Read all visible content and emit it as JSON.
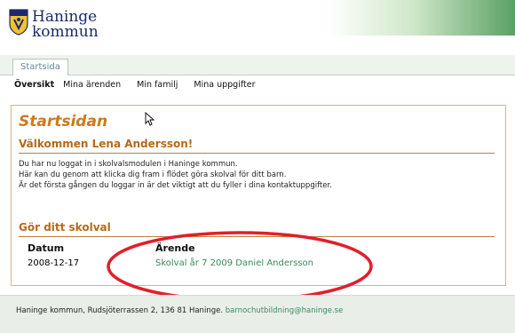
{
  "header": {
    "logo_line1": "Haninge",
    "logo_line2": "kommun"
  },
  "tabs": [
    {
      "label": "Startsida"
    }
  ],
  "subnav": [
    {
      "label": "Översikt"
    },
    {
      "label": "Mina ärenden"
    },
    {
      "label": "Min familj"
    },
    {
      "label": "Mina uppgifter"
    }
  ],
  "main": {
    "title": "Startsidan",
    "welcome": "Välkommen Lena Andersson!",
    "intro_lines": [
      "Du har nu loggat in i skolvalsmodulen i Haninge kommun.",
      "Här kan du genom att klicka dig fram i flödet göra skolval för ditt barn.",
      "Är det första gången du loggar in är det viktigt att du fyller i dina kontaktuppgifter."
    ],
    "section_title": "Gör ditt skolval",
    "table": {
      "headers": [
        "Datum",
        "Ärende"
      ],
      "rows": [
        {
          "date": "2008-12-17",
          "case": "Skolval år 7 2009 Daniel Andersson"
        }
      ]
    }
  },
  "footer": {
    "address": "Haninge kommun, Rudsjöterrassen 2, 136 81 Haninge.",
    "email": "barnochutbildning@haninge.se"
  },
  "colors": {
    "accent_orange": "#cc7a1c",
    "link_green": "#3a8a5a",
    "highlight_red": "#e0202a",
    "brand_blue": "#1a2a6b"
  },
  "icons": {
    "logo": "shield-crest-icon",
    "cursor": "mouse-pointer-icon"
  }
}
